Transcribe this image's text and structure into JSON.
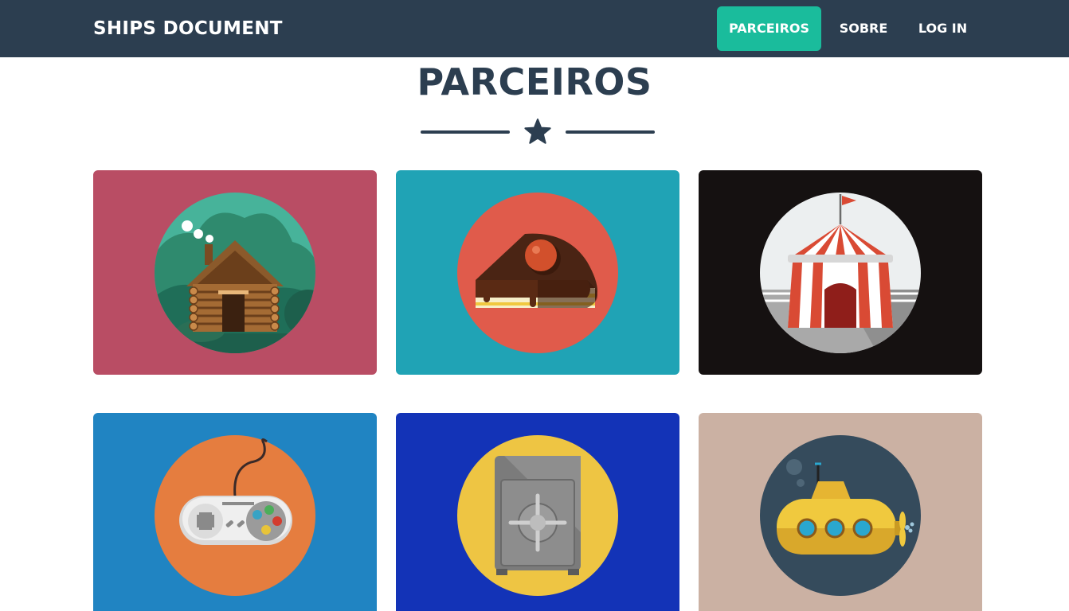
{
  "navbar": {
    "brand": "SHIPS DOCUMENT",
    "items": [
      {
        "label": "PARCEIROS",
        "active": true
      },
      {
        "label": "SOBRE",
        "active": false
      },
      {
        "label": "LOG IN",
        "active": false
      }
    ]
  },
  "section": {
    "title": "PARCEIROS",
    "divider_icon": "star-icon"
  },
  "portfolio": {
    "items": [
      {
        "icon": "cabin-icon",
        "background": "#b94d64",
        "circle": "#47b39a"
      },
      {
        "icon": "cake-icon",
        "background": "#20a3b5",
        "circle": "#e05b4b"
      },
      {
        "icon": "circus-tent-icon",
        "background": "#151111",
        "circle": "#eceff0"
      },
      {
        "icon": "game-controller-icon",
        "background": "#2084c2",
        "circle": "#e57d3f"
      },
      {
        "icon": "safe-icon",
        "background": "#1333b7",
        "circle": "#eec543"
      },
      {
        "icon": "submarine-icon",
        "background": "#cbb1a3",
        "circle": "#354b5c"
      }
    ]
  },
  "colors": {
    "navbar": "#2c3e50",
    "accent": "#1abc9c",
    "title": "#2c3e50"
  }
}
